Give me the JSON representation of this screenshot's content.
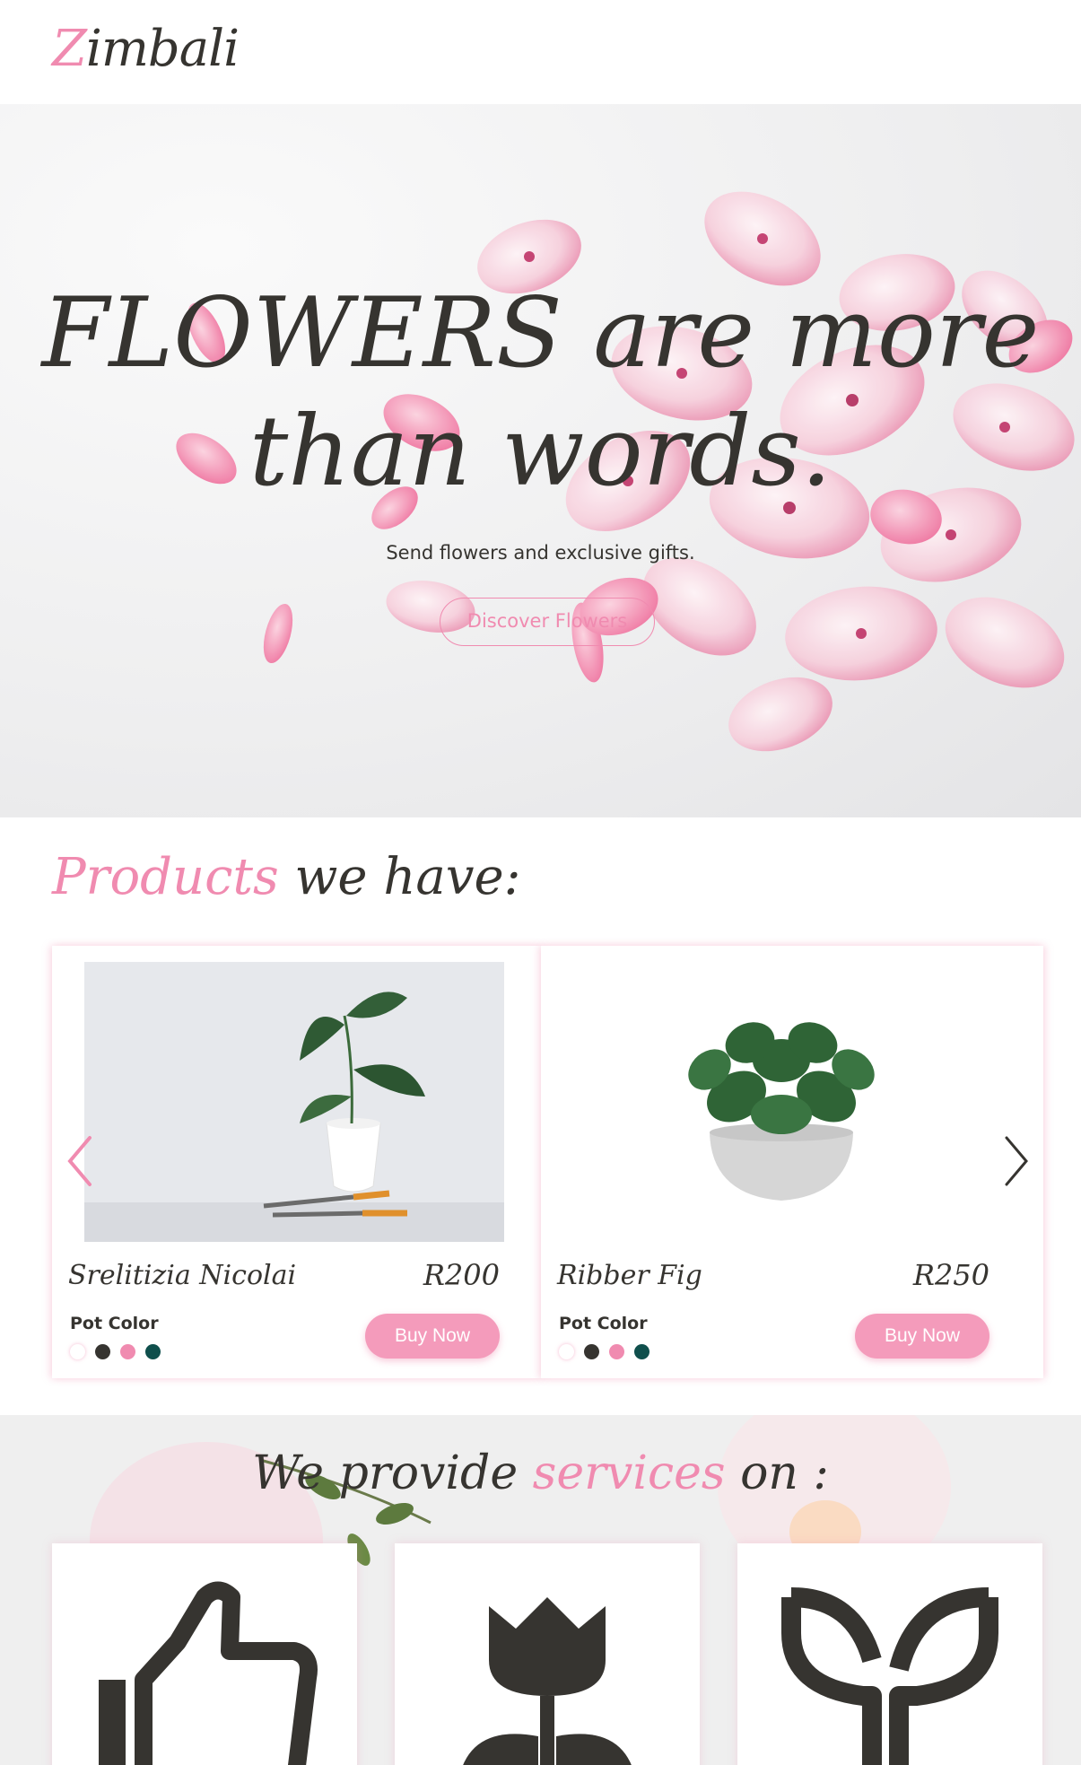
{
  "header": {
    "logo_first": "Z",
    "logo_rest": "imbali"
  },
  "hero": {
    "title_line1": "FLOWERS are more",
    "title_line2": "than words.",
    "subtitle": "Send flowers and exclusive gifts.",
    "cta_label": "Discover Flowers"
  },
  "products": {
    "title_highlight": "Products",
    "title_rest": " we have:",
    "items": [
      {
        "name": "Srelitizia Nicolai",
        "price": "R200",
        "pot_label": "Pot Color",
        "buy_label": "Buy Now",
        "swatches": [
          "#ffffff",
          "#363430",
          "#f08bb0",
          "#0f4f4c"
        ]
      },
      {
        "name": "Ribber Fig",
        "price": "R250",
        "pot_label": "Pot Color",
        "buy_label": "Buy Now",
        "swatches": [
          "#ffffff",
          "#363430",
          "#f08bb0",
          "#0f4f4c"
        ]
      }
    ]
  },
  "services": {
    "title_before": "We provide ",
    "title_highlight": "services",
    "title_after": " on :",
    "items": [
      {
        "icon": "thumbs-up-icon"
      },
      {
        "icon": "tulip-icon"
      },
      {
        "icon": "sprout-icon"
      }
    ]
  },
  "colors": {
    "accent": "#f08bb0",
    "text": "#363430",
    "button": "#f49bbb"
  }
}
